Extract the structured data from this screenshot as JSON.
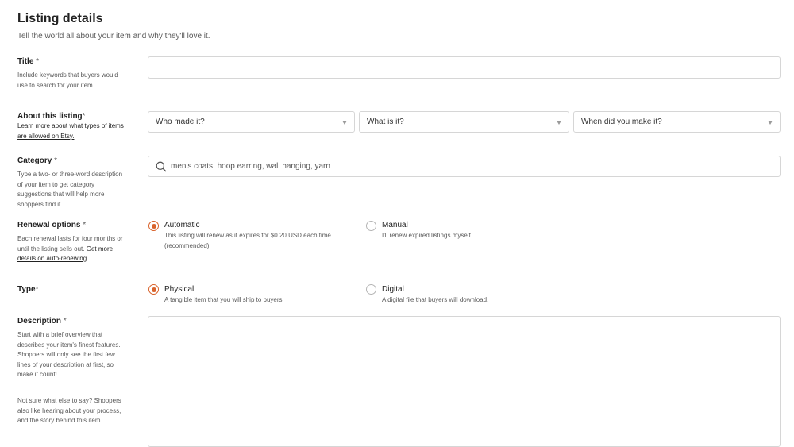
{
  "header": {
    "title": "Listing details",
    "subtitle": "Tell the world all about your item and why they'll love it."
  },
  "title_field": {
    "label": "Title",
    "required_mark": " *",
    "description": "Include keywords that buyers would use to search for your item.",
    "value": ""
  },
  "about": {
    "label": "About this listing",
    "required_mark": "*",
    "link": "Learn more about what types of items are allowed on Etsy.",
    "selects": [
      {
        "value": "Who made it?"
      },
      {
        "value": "What is it?"
      },
      {
        "value": "When did you make it?"
      }
    ]
  },
  "category": {
    "label": "Category",
    "required_mark": " *",
    "description": "Type a two- or three-word description of your item to get category suggestions that will help more shoppers find it.",
    "placeholder": "men's coats, hoop earring, wall hanging, yarn",
    "icon": "search-icon"
  },
  "renewal": {
    "label": "Renewal options",
    "required_mark": " *",
    "description": "Each renewal lasts for four months or until the listing sells out.",
    "link": "Get more details on auto-renewing",
    "options": [
      {
        "title": "Automatic",
        "description": "This listing will renew as it expires for $0.20 USD each time (recommended).",
        "selected": true
      },
      {
        "title": "Manual",
        "description": "I'll renew expired listings myself.",
        "selected": false
      }
    ]
  },
  "type": {
    "label": "Type",
    "required_mark": "*",
    "options": [
      {
        "title": "Physical",
        "description": "A tangible item that you will ship to buyers.",
        "selected": true
      },
      {
        "title": "Digital",
        "description": "A digital file that buyers will download.",
        "selected": false
      }
    ]
  },
  "description_field": {
    "label": "Description",
    "required_mark": " *",
    "help_1": "Start with a brief overview that describes your item's finest features. Shoppers will only see the first few lines of your description at first, so make it count!",
    "help_2": "Not sure what else to say? Shoppers also like hearing about your process, and the story behind this item.",
    "value": ""
  },
  "colors": {
    "accent": "#d9632c",
    "border": "#d6d6d6"
  }
}
